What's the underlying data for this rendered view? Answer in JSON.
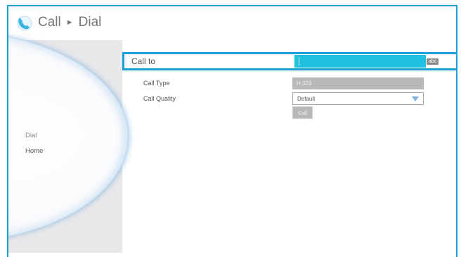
{
  "header": {
    "section": "Call",
    "page": "Dial",
    "separator": "►"
  },
  "menu": {
    "items": [
      {
        "label": "Dial"
      },
      {
        "label": "Home"
      }
    ]
  },
  "form": {
    "call_to": {
      "label": "Call to",
      "value": "",
      "keyboard_badge": "abc"
    },
    "call_type": {
      "label": "Call Type",
      "value": "H.323"
    },
    "call_quality": {
      "label": "Call Quality",
      "value": "Default"
    },
    "call_button": "Call"
  },
  "colors": {
    "accent": "#1aa0d8",
    "input_active": "#21bfe0",
    "disabled": "#b9b9bb"
  }
}
